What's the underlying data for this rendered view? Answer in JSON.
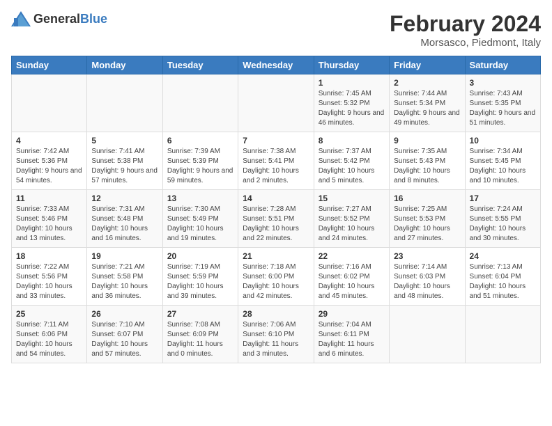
{
  "logo": {
    "general": "General",
    "blue": "Blue"
  },
  "title": "February 2024",
  "subtitle": "Morsasco, Piedmont, Italy",
  "days_of_week": [
    "Sunday",
    "Monday",
    "Tuesday",
    "Wednesday",
    "Thursday",
    "Friday",
    "Saturday"
  ],
  "weeks": [
    [
      {
        "day": "",
        "details": ""
      },
      {
        "day": "",
        "details": ""
      },
      {
        "day": "",
        "details": ""
      },
      {
        "day": "",
        "details": ""
      },
      {
        "day": "1",
        "details": "Sunrise: 7:45 AM\nSunset: 5:32 PM\nDaylight: 9 hours and 46 minutes."
      },
      {
        "day": "2",
        "details": "Sunrise: 7:44 AM\nSunset: 5:34 PM\nDaylight: 9 hours and 49 minutes."
      },
      {
        "day": "3",
        "details": "Sunrise: 7:43 AM\nSunset: 5:35 PM\nDaylight: 9 hours and 51 minutes."
      }
    ],
    [
      {
        "day": "4",
        "details": "Sunrise: 7:42 AM\nSunset: 5:36 PM\nDaylight: 9 hours and 54 minutes."
      },
      {
        "day": "5",
        "details": "Sunrise: 7:41 AM\nSunset: 5:38 PM\nDaylight: 9 hours and 57 minutes."
      },
      {
        "day": "6",
        "details": "Sunrise: 7:39 AM\nSunset: 5:39 PM\nDaylight: 9 hours and 59 minutes."
      },
      {
        "day": "7",
        "details": "Sunrise: 7:38 AM\nSunset: 5:41 PM\nDaylight: 10 hours and 2 minutes."
      },
      {
        "day": "8",
        "details": "Sunrise: 7:37 AM\nSunset: 5:42 PM\nDaylight: 10 hours and 5 minutes."
      },
      {
        "day": "9",
        "details": "Sunrise: 7:35 AM\nSunset: 5:43 PM\nDaylight: 10 hours and 8 minutes."
      },
      {
        "day": "10",
        "details": "Sunrise: 7:34 AM\nSunset: 5:45 PM\nDaylight: 10 hours and 10 minutes."
      }
    ],
    [
      {
        "day": "11",
        "details": "Sunrise: 7:33 AM\nSunset: 5:46 PM\nDaylight: 10 hours and 13 minutes."
      },
      {
        "day": "12",
        "details": "Sunrise: 7:31 AM\nSunset: 5:48 PM\nDaylight: 10 hours and 16 minutes."
      },
      {
        "day": "13",
        "details": "Sunrise: 7:30 AM\nSunset: 5:49 PM\nDaylight: 10 hours and 19 minutes."
      },
      {
        "day": "14",
        "details": "Sunrise: 7:28 AM\nSunset: 5:51 PM\nDaylight: 10 hours and 22 minutes."
      },
      {
        "day": "15",
        "details": "Sunrise: 7:27 AM\nSunset: 5:52 PM\nDaylight: 10 hours and 24 minutes."
      },
      {
        "day": "16",
        "details": "Sunrise: 7:25 AM\nSunset: 5:53 PM\nDaylight: 10 hours and 27 minutes."
      },
      {
        "day": "17",
        "details": "Sunrise: 7:24 AM\nSunset: 5:55 PM\nDaylight: 10 hours and 30 minutes."
      }
    ],
    [
      {
        "day": "18",
        "details": "Sunrise: 7:22 AM\nSunset: 5:56 PM\nDaylight: 10 hours and 33 minutes."
      },
      {
        "day": "19",
        "details": "Sunrise: 7:21 AM\nSunset: 5:58 PM\nDaylight: 10 hours and 36 minutes."
      },
      {
        "day": "20",
        "details": "Sunrise: 7:19 AM\nSunset: 5:59 PM\nDaylight: 10 hours and 39 minutes."
      },
      {
        "day": "21",
        "details": "Sunrise: 7:18 AM\nSunset: 6:00 PM\nDaylight: 10 hours and 42 minutes."
      },
      {
        "day": "22",
        "details": "Sunrise: 7:16 AM\nSunset: 6:02 PM\nDaylight: 10 hours and 45 minutes."
      },
      {
        "day": "23",
        "details": "Sunrise: 7:14 AM\nSunset: 6:03 PM\nDaylight: 10 hours and 48 minutes."
      },
      {
        "day": "24",
        "details": "Sunrise: 7:13 AM\nSunset: 6:04 PM\nDaylight: 10 hours and 51 minutes."
      }
    ],
    [
      {
        "day": "25",
        "details": "Sunrise: 7:11 AM\nSunset: 6:06 PM\nDaylight: 10 hours and 54 minutes."
      },
      {
        "day": "26",
        "details": "Sunrise: 7:10 AM\nSunset: 6:07 PM\nDaylight: 10 hours and 57 minutes."
      },
      {
        "day": "27",
        "details": "Sunrise: 7:08 AM\nSunset: 6:09 PM\nDaylight: 11 hours and 0 minutes."
      },
      {
        "day": "28",
        "details": "Sunrise: 7:06 AM\nSunset: 6:10 PM\nDaylight: 11 hours and 3 minutes."
      },
      {
        "day": "29",
        "details": "Sunrise: 7:04 AM\nSunset: 6:11 PM\nDaylight: 11 hours and 6 minutes."
      },
      {
        "day": "",
        "details": ""
      },
      {
        "day": "",
        "details": ""
      }
    ]
  ]
}
